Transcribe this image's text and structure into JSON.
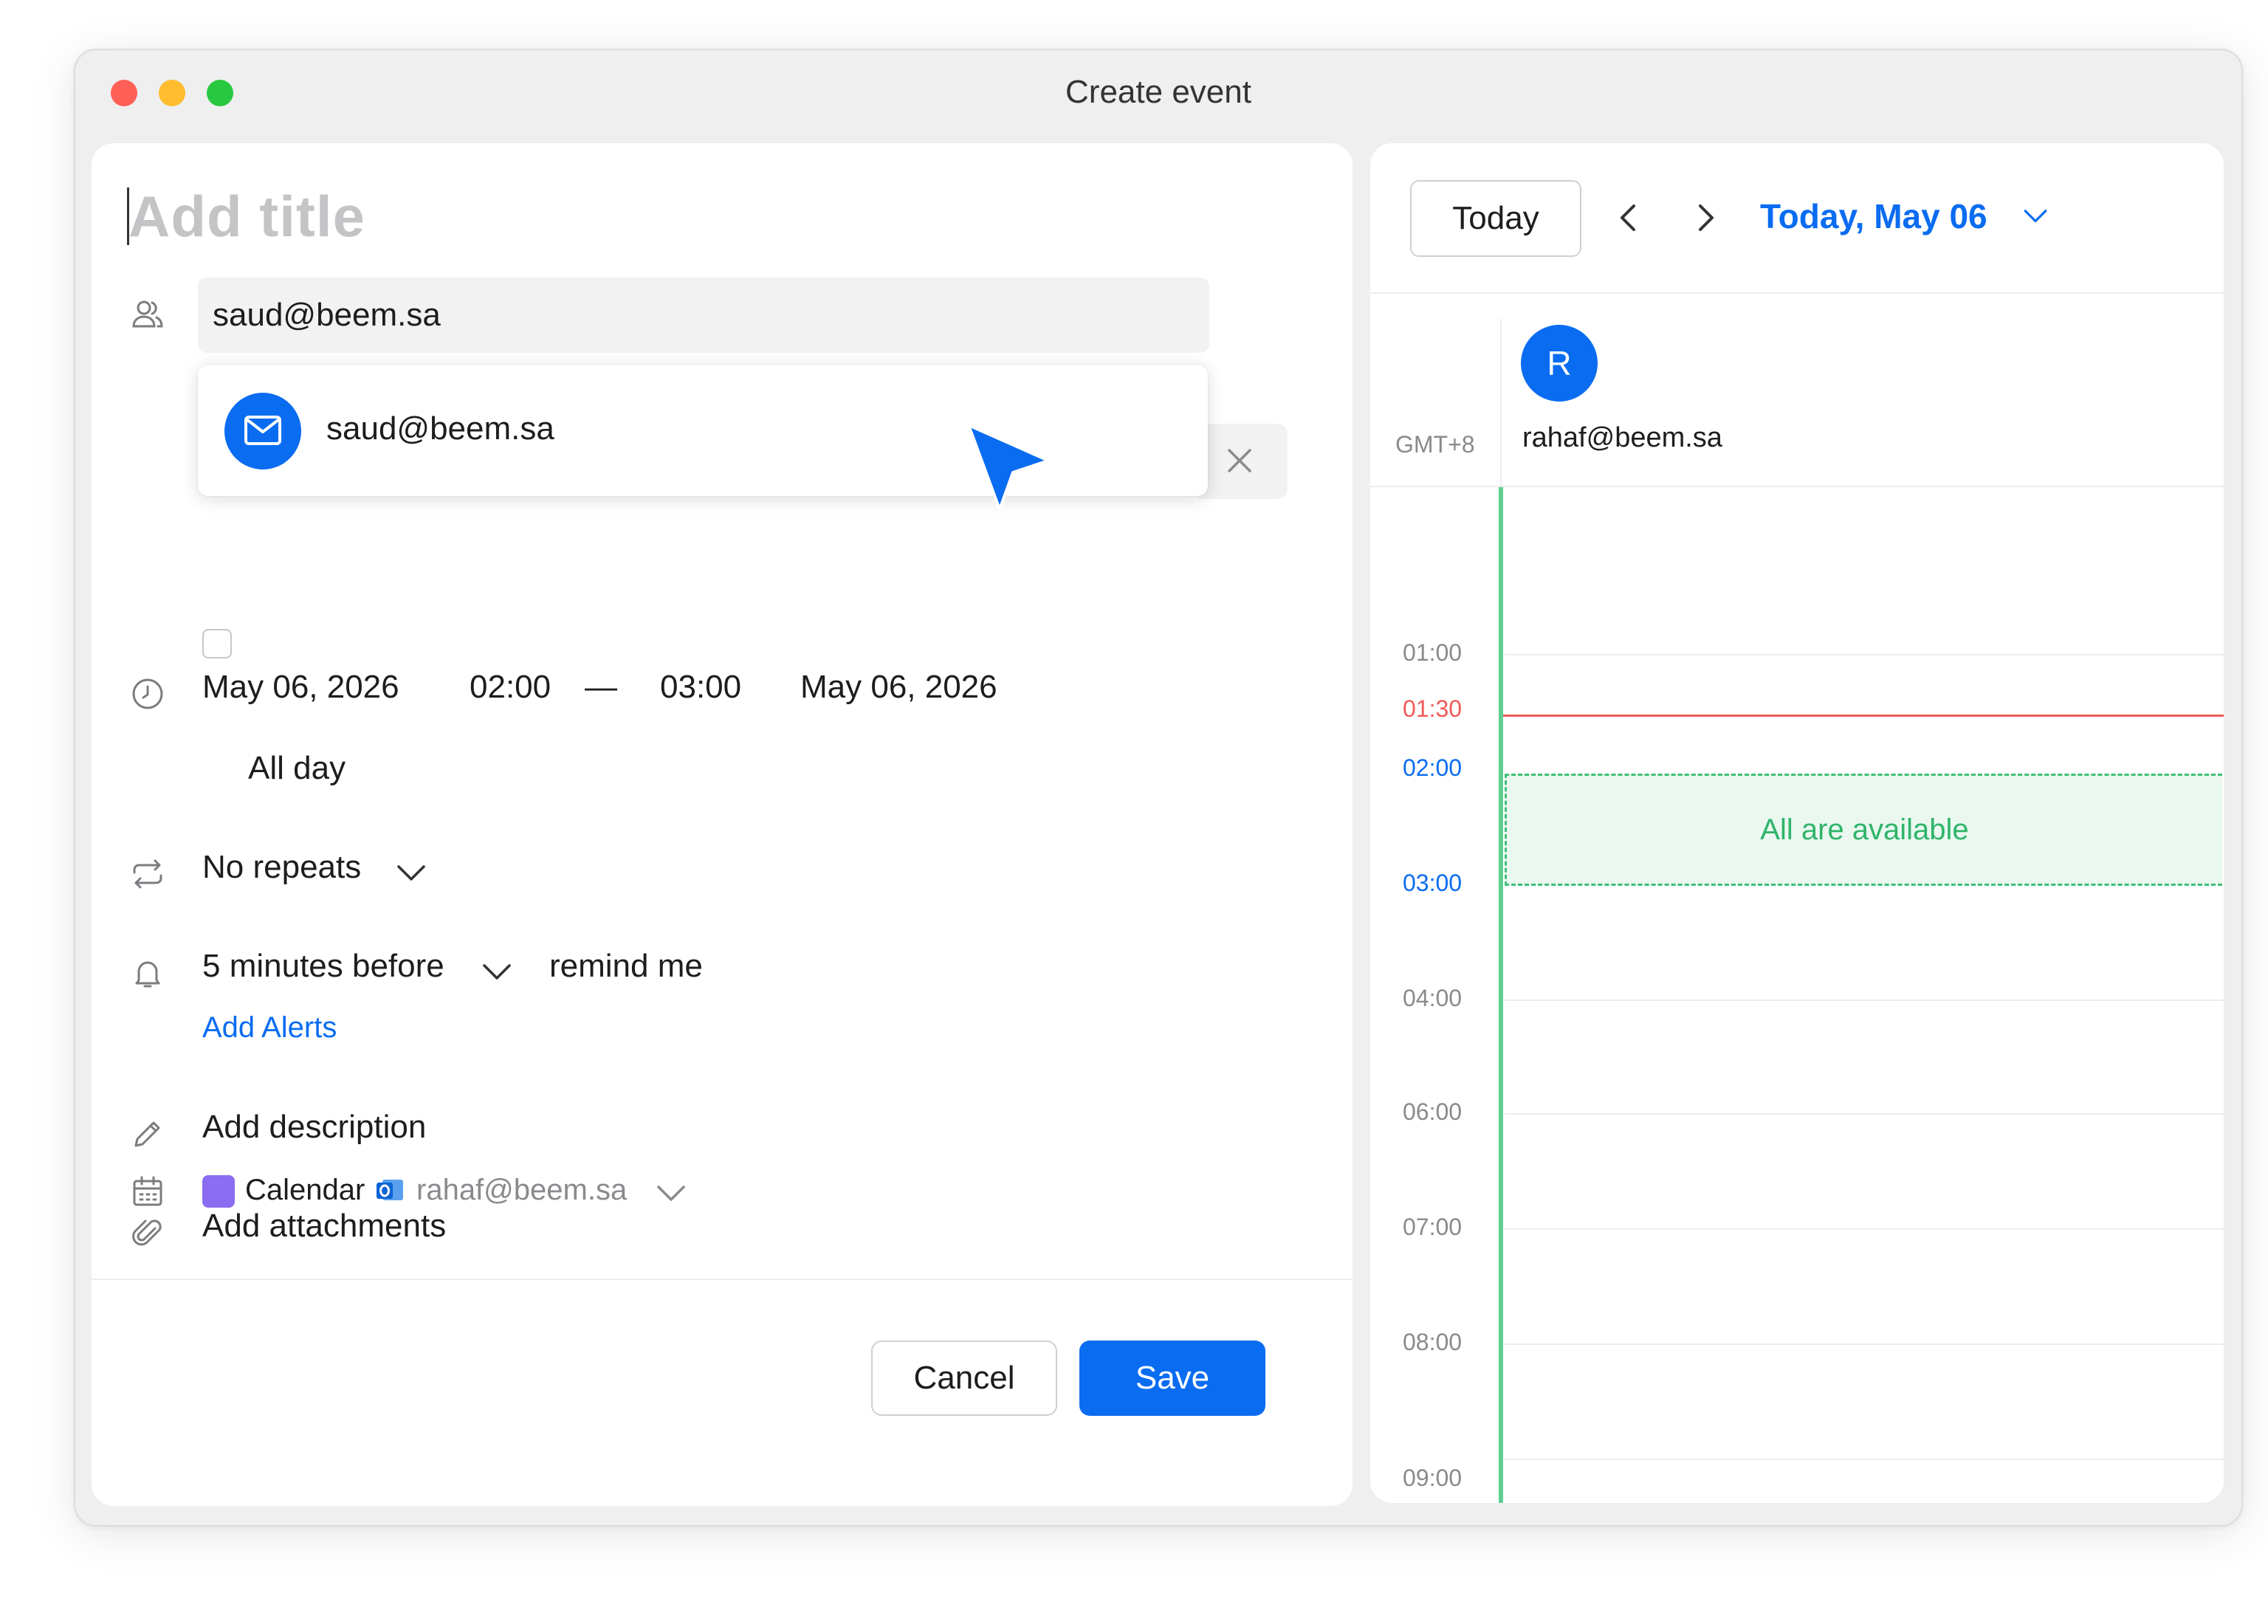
{
  "window": {
    "title": "Create event"
  },
  "form": {
    "title_placeholder": "Add title",
    "attendee_input_value": "saud@beem.sa",
    "suggestion": {
      "email": "saud@beem.sa"
    },
    "date_time": {
      "start_date": "May 06, 2026",
      "start_time": "02:00",
      "separator": "—",
      "end_time": "03:00",
      "end_date": "May 06, 2026"
    },
    "all_day_label": "All day",
    "repeat_label": "No repeats",
    "reminder": {
      "value": "5 minutes before",
      "suffix": "remind me",
      "add_alerts": "Add Alerts"
    },
    "description_label": "Add description",
    "attachments_label": "Add attachments",
    "calendar": {
      "name": "Calendar",
      "account": "rahaf@beem.sa",
      "swatch_color": "#8a6df1"
    },
    "buttons": {
      "cancel": "Cancel",
      "save": "Save"
    }
  },
  "schedule": {
    "today_button": "Today",
    "date_title": "Today, May 06",
    "timezone": "GMT+8",
    "attendee": {
      "initial": "R",
      "email": "rahaf@beem.sa"
    },
    "hours": {
      "h0100": "01:00",
      "now": "01:30",
      "h0200": "02:00",
      "h0300": "03:00",
      "h0400": "04:00",
      "h0600": "06:00",
      "h0700": "07:00",
      "h0800": "08:00",
      "h0900": "09:00"
    },
    "availability_text": "All are available"
  },
  "colors": {
    "accent": "#0a6cf1",
    "now_line": "#f05a5a",
    "available": "#2fb46a"
  }
}
